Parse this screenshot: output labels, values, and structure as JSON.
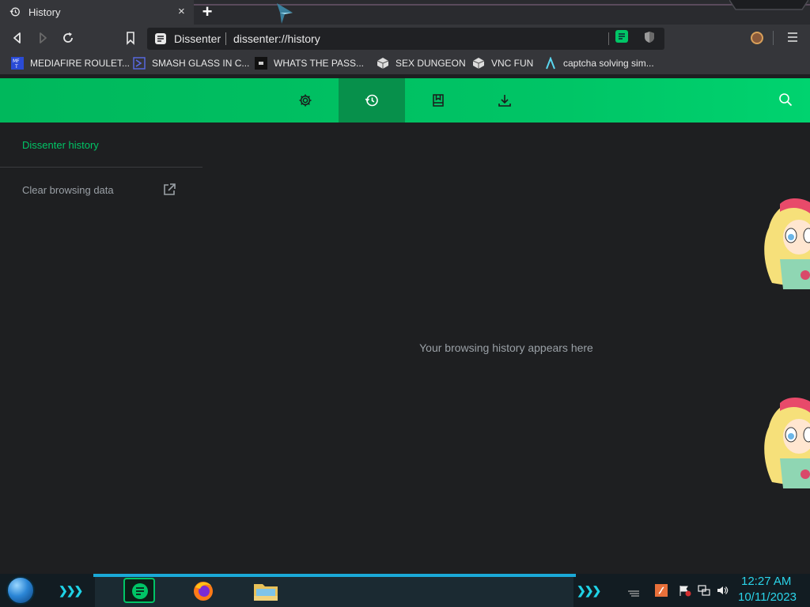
{
  "tab": {
    "title": "History",
    "close": "×",
    "new_tab": "+"
  },
  "toolbar": {
    "site_name": "Dissenter",
    "url": "dissenter://history"
  },
  "bookmarks": [
    {
      "label": "MEDIAFIRE ROULET...",
      "icon": "mediafire-icon"
    },
    {
      "label": "SMASH GLASS IN C...",
      "icon": "chevron-box-icon"
    },
    {
      "label": "WHATS THE PASS...",
      "icon": "terminal-icon"
    },
    {
      "label": "SEX DUNGEON",
      "icon": "cube-icon"
    },
    {
      "label": "VNC FUN",
      "icon": "cube-icon"
    },
    {
      "label": "captcha solving sim...",
      "icon": "lambda-icon"
    }
  ],
  "header": {
    "tabs": [
      "settings",
      "history",
      "bookmarks",
      "downloads"
    ],
    "active": "history"
  },
  "sidebar": {
    "title": "Dissenter history",
    "clear": "Clear browsing data"
  },
  "main": {
    "empty": "Your browsing history appears here"
  },
  "taskbar": {
    "time": "12:27 AM",
    "date": "10/11/2023"
  },
  "colors": {
    "accent": "#00c566",
    "active_tab": "#07904b",
    "clock": "#2ad4e9"
  }
}
